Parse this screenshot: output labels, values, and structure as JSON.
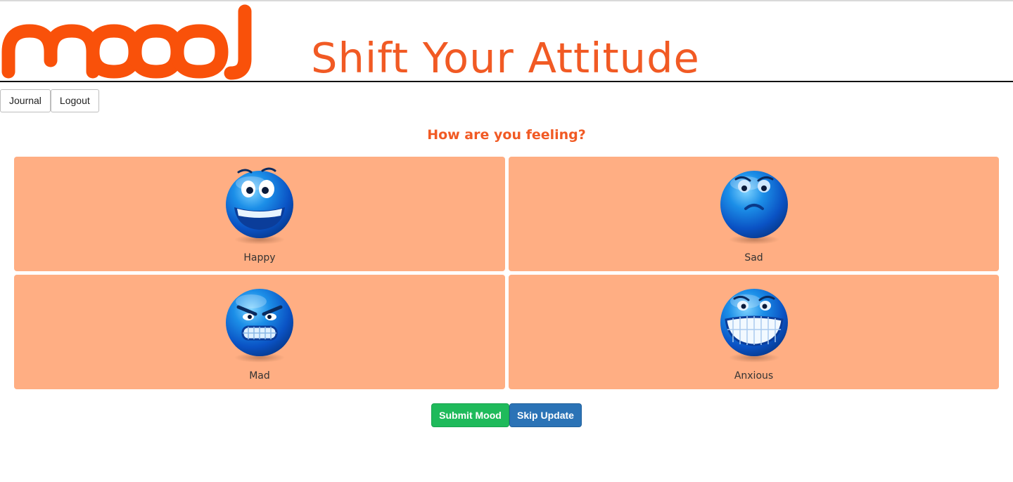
{
  "header": {
    "logo_text": "mood",
    "site_title": "Shift Your Attitude",
    "brand_color": "#f15a24"
  },
  "nav": {
    "journal_label": "Journal",
    "logout_label": "Logout"
  },
  "main": {
    "question": "How are you feeling?",
    "moods": [
      {
        "label": "Happy",
        "icon": "happy-face-icon"
      },
      {
        "label": "Sad",
        "icon": "sad-face-icon"
      },
      {
        "label": "Mad",
        "icon": "mad-face-icon"
      },
      {
        "label": "Anxious",
        "icon": "anxious-face-icon"
      }
    ],
    "card_color": "#ffae83"
  },
  "actions": {
    "submit_label": "Submit Mood",
    "skip_label": "Skip Update",
    "submit_color": "#1fba5b",
    "skip_color": "#2b73b6"
  }
}
